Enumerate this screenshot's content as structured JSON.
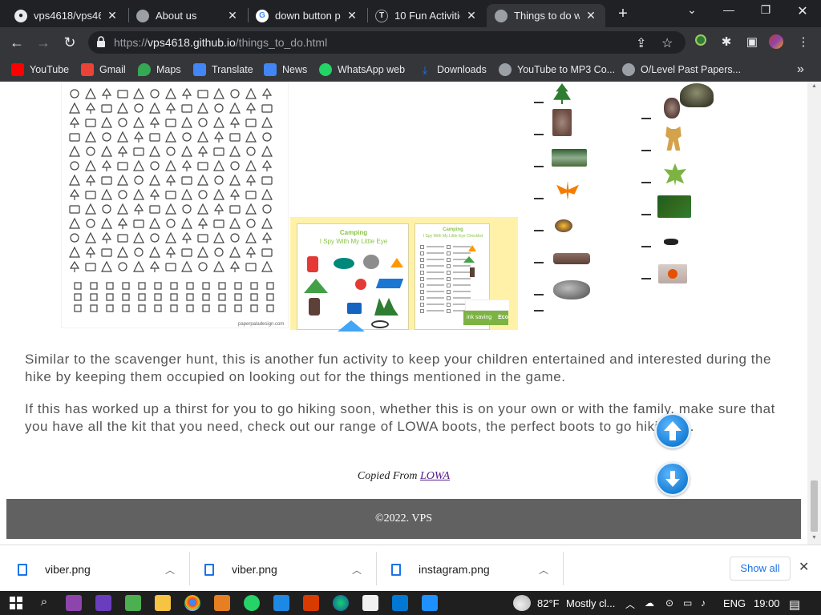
{
  "tabs": [
    {
      "title": "vps4618/vps461",
      "close": "✕"
    },
    {
      "title": "About us",
      "close": "✕"
    },
    {
      "title": "down button pr",
      "close": "✕"
    },
    {
      "title": "10 Fun Activitie",
      "close": "✕"
    },
    {
      "title": "Things to do wh",
      "close": "✕"
    }
  ],
  "new_tab": "+",
  "window": {
    "minimize": "—",
    "maximize": "❐",
    "close": "✕",
    "tab_search": "⌄"
  },
  "address": {
    "scheme": "https://",
    "host": "vps4618.github.io",
    "path": "/things_to_do.html"
  },
  "nav": {
    "back": "←",
    "forward": "→",
    "reload": "↻"
  },
  "bookmarks": [
    {
      "label": "YouTube",
      "color": "#ff0000"
    },
    {
      "label": "Gmail",
      "color": "#ea4335"
    },
    {
      "label": "Maps",
      "color": "#34a853"
    },
    {
      "label": "Translate",
      "color": "#4285f4"
    },
    {
      "label": "News",
      "color": "#4285f4"
    },
    {
      "label": "WhatsApp web",
      "color": "#25d366"
    },
    {
      "label": "Downloads",
      "color": "#1a73e8"
    },
    {
      "label": "YouTube to MP3 Co...",
      "color": "#9aa0a6"
    },
    {
      "label": "O/Level Past Papers...",
      "color": "#9aa0a6"
    }
  ],
  "bookmarks_more": "»",
  "image_text": {
    "card_title": "Camping",
    "card_subtitle": "I Spy With My Little Eye",
    "card2_title": "Camping",
    "card2_subtitle": "I Spy With My Little Eye Checklist",
    "ink_saving": "ink saving",
    "eco": "Eco",
    "source": "paperpaladesign.com"
  },
  "content": {
    "para1": "Similar to the scavenger hunt, this is another fun activity to keep your children entertained and interested during the hike by keeping them occupied on looking out for the things mentioned in the game.",
    "para2": "If this has worked up a thirst for you to go hiking soon, whether this is on your own or with the family, make sure that you have all the kit that you need, check out our range of LOWA boots, the perfect boots to go hiking in.",
    "credit_prefix": "Copied From ",
    "credit_link": "LOWA",
    "footer": "©2022. VPS"
  },
  "downloads": [
    {
      "file": "viber.png"
    },
    {
      "file": "viber.png"
    },
    {
      "file": "instagram.png"
    }
  ],
  "show_all": "Show all",
  "taskbar": {
    "weather_temp": "82°F",
    "weather_desc": "Mostly cl...",
    "lang": "ENG",
    "time": "19:00"
  }
}
